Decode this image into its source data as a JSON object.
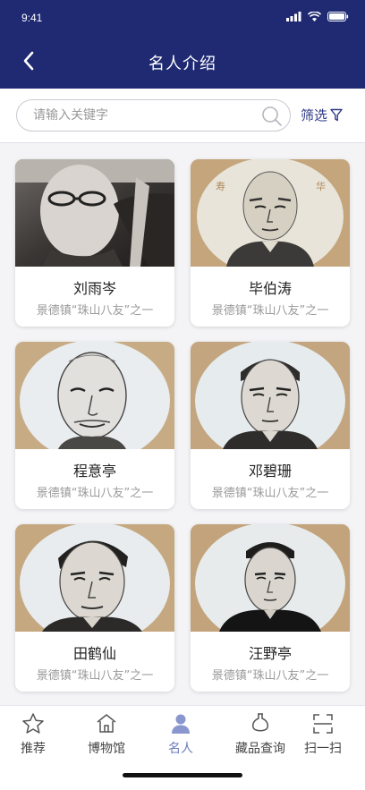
{
  "status": {
    "time": "9:41"
  },
  "header": {
    "title": "名人介绍"
  },
  "search": {
    "placeholder": "请输入关键字",
    "filter_label": "筛选"
  },
  "people": [
    {
      "name": "刘雨岑",
      "desc": "景德镇“珠山八友”之一"
    },
    {
      "name": "毕伯涛",
      "desc": "景德镇“珠山八友”之一"
    },
    {
      "name": "程意亭",
      "desc": "景德镇“珠山八友”之一"
    },
    {
      "name": "邓碧珊",
      "desc": "景德镇“珠山八友”之一"
    },
    {
      "name": "田鹤仙",
      "desc": "景德镇“珠山八友”之一"
    },
    {
      "name": "汪野亭",
      "desc": "景德镇“珠山八友”之一"
    }
  ],
  "tabs": [
    {
      "label": "推荐",
      "icon": "star-icon"
    },
    {
      "label": "博物馆",
      "icon": "museum-icon"
    },
    {
      "label": "名人",
      "icon": "person-icon",
      "active": true
    },
    {
      "label": "藏品查询",
      "icon": "vase-icon"
    },
    {
      "label": "扫一扫",
      "icon": "scan-icon"
    }
  ],
  "colors": {
    "header": "#1f2a72",
    "accent": "#2f3a86",
    "active_tab": "#6b7bbd"
  }
}
